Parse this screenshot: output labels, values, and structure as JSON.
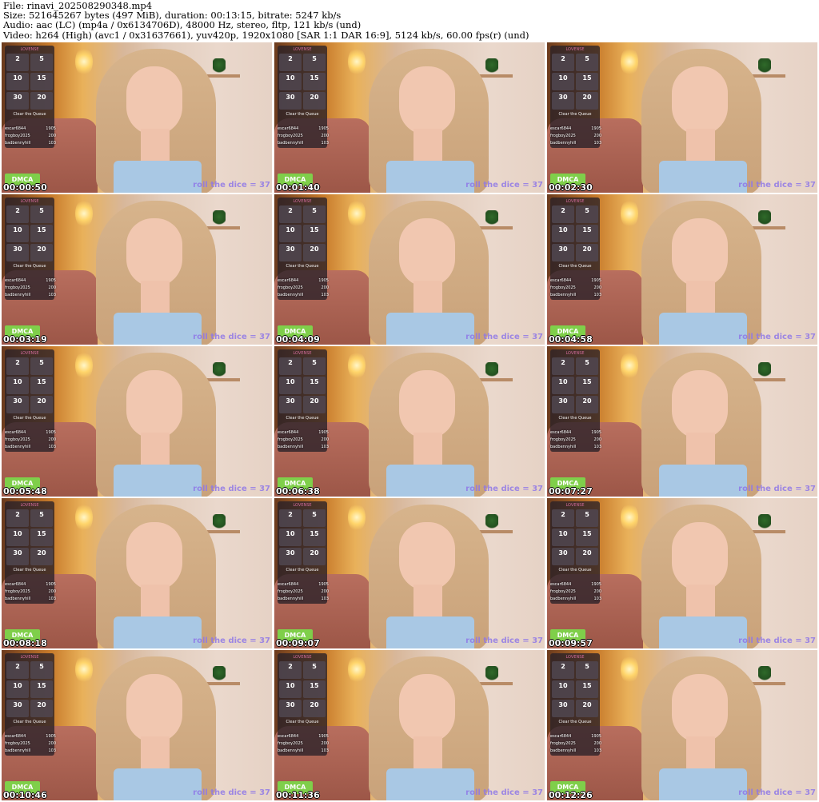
{
  "header": {
    "file": "File: rinavi_202508290348.mp4",
    "size": "Size: 521645267 bytes (497 MiB), duration: 00:13:15, bitrate: 5247 kb/s",
    "audio": "Audio: aac (LC) (mp4a / 0x6134706D), 48000 Hz, stereo, fltp, 121 kb/s (und)",
    "video": "Video: h264 (High) (avc1 / 0x31637661), yuv420p, 1920x1080 [SAR 1:1 DAR 16:9], 5124 kb/s, 60.00 fps(r) (und)"
  },
  "overlay": {
    "panel_title": "LOVENSE",
    "queue_label": "Clear the Queue",
    "leaders": [
      {
        "name": "escar6844",
        "value": "1905"
      },
      {
        "name": "frogboy2025",
        "value": "200"
      },
      {
        "name": "badbennyhill",
        "value": "103"
      }
    ],
    "badge": "DMCA",
    "roll_text": "roll the dice = 37",
    "tiles": [
      "2",
      "5",
      "10",
      "15",
      "30",
      "20"
    ]
  },
  "thumbnails": [
    {
      "time": "00:00:50"
    },
    {
      "time": "00:01:40"
    },
    {
      "time": "00:02:30"
    },
    {
      "time": "00:03:19"
    },
    {
      "time": "00:04:09"
    },
    {
      "time": "00:04:58"
    },
    {
      "time": "00:05:48"
    },
    {
      "time": "00:06:38"
    },
    {
      "time": "00:07:27"
    },
    {
      "time": "00:08:18"
    },
    {
      "time": "00:09:07"
    },
    {
      "time": "00:09:57"
    },
    {
      "time": "00:10:46"
    },
    {
      "time": "00:11:36"
    },
    {
      "time": "00:12:26"
    }
  ]
}
